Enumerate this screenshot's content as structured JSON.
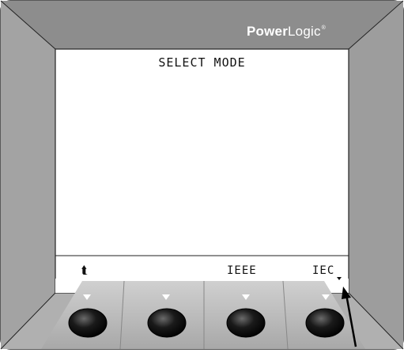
{
  "header": {
    "brand_bold": "Power",
    "brand_light": "Logic",
    "brand_mark": "®"
  },
  "screen": {
    "title": "SELECT MODE"
  },
  "softkeys": [
    {
      "label": "⮬"
    },
    {
      "label": ""
    },
    {
      "label": "IEEE"
    },
    {
      "label": "IEC"
    }
  ],
  "colors": {
    "bezel": "#9a9a9a",
    "bezel_light": "#c8c8c8",
    "screen": "#ffffff",
    "button": "#1a1a1a"
  },
  "icons": [
    "up-arrow-icon",
    "pointer-arrow-icon"
  ]
}
